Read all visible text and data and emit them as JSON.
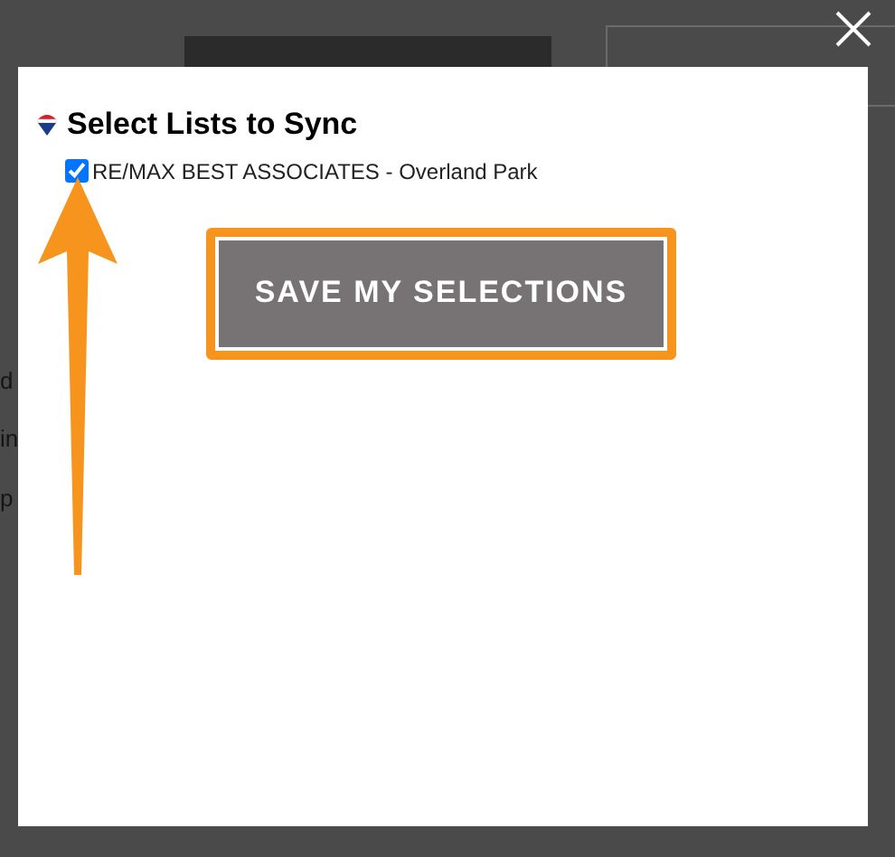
{
  "background_text": [
    "d",
    "in",
    "p"
  ],
  "dialog": {
    "title": "Select Lists to Sync",
    "lists": [
      {
        "label": "RE/MAX BEST ASSOCIATES - Overland Park",
        "checked": true
      }
    ],
    "save_button": "SAVE MY SELECTIONS"
  }
}
